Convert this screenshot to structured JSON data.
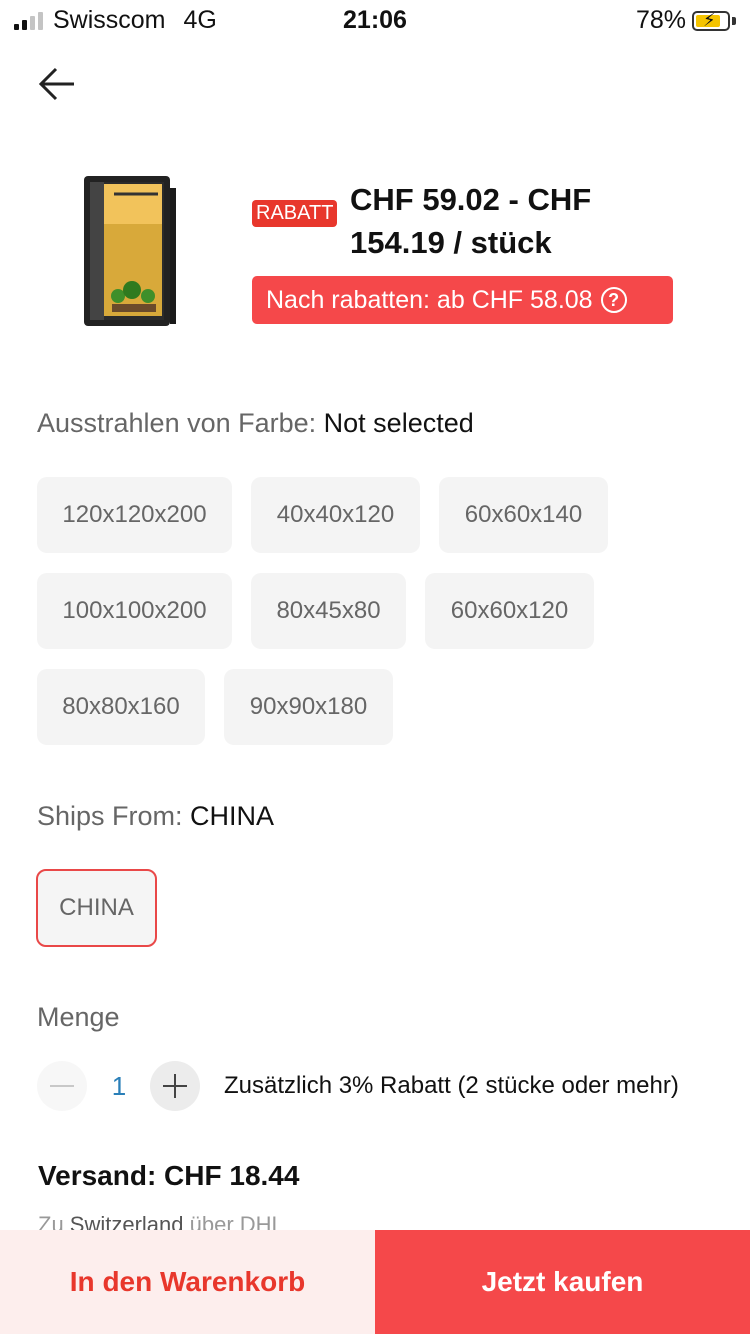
{
  "status_bar": {
    "carrier": "Swisscom",
    "network": "4G",
    "time": "21:06",
    "battery": "78%"
  },
  "header": {
    "back_icon": "arrow-left-icon"
  },
  "product": {
    "badge": "RABATT",
    "price_line1": "CHF 59.02 - CHF",
    "price_line2": "154.19 / stück",
    "discount_text": "Nach rabatten: ab CHF 58.08",
    "help_icon": "?"
  },
  "color_section": {
    "label": "Ausstrahlen von Farbe: ",
    "value": "Not selected",
    "options": [
      "120x120x200",
      "40x40x120",
      "60x60x140",
      "100x100x200",
      "80x45x80",
      "60x60x120",
      "80x80x160",
      "90x90x180"
    ]
  },
  "ships_from": {
    "label": "Ships From: ",
    "value": "CHINA",
    "options": [
      "CHINA"
    ]
  },
  "quantity": {
    "label": "Menge",
    "value": "1",
    "note": "Zusätzlich 3% Rabatt (2 stücke oder mehr)"
  },
  "shipping": {
    "title": "Versand: CHF 18.44",
    "prefix": "Zu ",
    "country": "Switzerland",
    "suffix": " über DHL"
  },
  "actions": {
    "cart": "In den Warenkorb",
    "buy": "Jetzt kaufen"
  },
  "colors": {
    "accent": "#f5484a",
    "badge": "#e8372c",
    "cart_bg": "#fdeeed"
  }
}
